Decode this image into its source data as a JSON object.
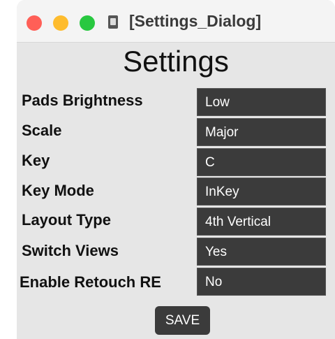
{
  "window": {
    "title": "[Settings_Dialog]",
    "controls": [
      "close",
      "minimize",
      "maximize"
    ],
    "icon": "document-icon"
  },
  "dialog": {
    "heading": "Settings",
    "rows": [
      {
        "label": "Pads Brightness",
        "value": "Low"
      },
      {
        "label": "Scale",
        "value": "Major"
      },
      {
        "label": "Key",
        "value": "C"
      },
      {
        "label": "Key Mode",
        "value": "InKey"
      },
      {
        "label": "Layout Type",
        "value": "4th Vertical"
      },
      {
        "label": "Switch Views",
        "value": "Yes"
      },
      {
        "label": "Enable Retouch RE",
        "value": "No"
      }
    ],
    "save_label": "SAVE"
  },
  "colors": {
    "close": "#ff5f57",
    "minimize": "#febc2e",
    "maximize": "#28c840",
    "field_background": "#3b3b3b",
    "window_background": "#e6e6e6"
  }
}
